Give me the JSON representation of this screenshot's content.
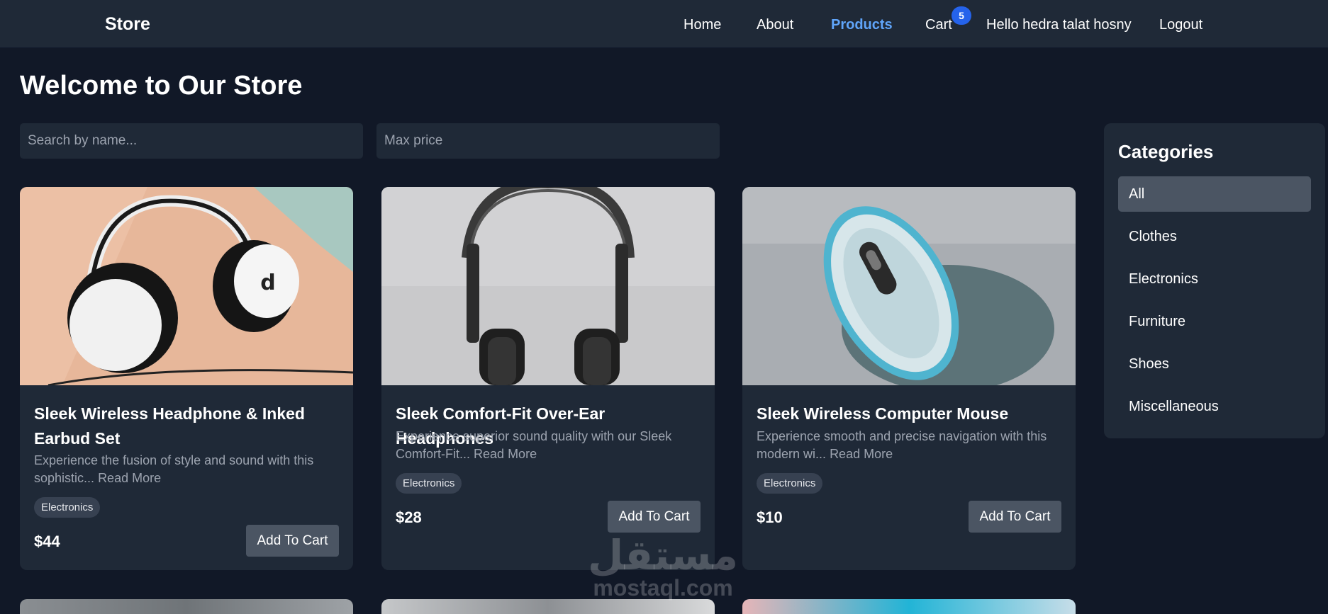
{
  "nav": {
    "brand": "Store",
    "links": [
      "Home",
      "About",
      "Products",
      "Cart",
      "Hello hedra talat hosny",
      "Logout"
    ],
    "active": "Products",
    "cart_count": "5"
  },
  "page_title": "Welcome to Our Store",
  "filters": {
    "search_placeholder": "Search by name...",
    "price_placeholder": "Max price"
  },
  "products": [
    {
      "title": "Sleek Wireless Headphone & Inked Earbud Set",
      "desc": "Experience the fusion of style and sound with this sophistic...",
      "read_more": "Read More",
      "category": "Electronics",
      "price": "$44",
      "button": "Add To Cart"
    },
    {
      "title": "Sleek Comfort-Fit Over-Ear Headphones",
      "desc": "Experience superior sound quality with our Sleek Comfort-Fit...",
      "read_more": "Read More",
      "category": "Electronics",
      "price": "$28",
      "button": "Add To Cart"
    },
    {
      "title": "Sleek Wireless Computer Mouse",
      "desc": "Experience smooth and precise navigation with this modern wi...",
      "read_more": "Read More",
      "category": "Electronics",
      "price": "$10",
      "button": "Add To Cart"
    }
  ],
  "sidebar": {
    "title": "Categories",
    "items": [
      "All",
      "Clothes",
      "Electronics",
      "Furniture",
      "Shoes",
      "Miscellaneous"
    ],
    "active": "All"
  },
  "watermark": {
    "arabic": "مستقل",
    "latin": "mostaql.com"
  },
  "colors": {
    "background": "#111827",
    "surface": "#1f2937",
    "accent": "#60a5fa",
    "badge": "#2563eb",
    "button": "#4b5563"
  }
}
